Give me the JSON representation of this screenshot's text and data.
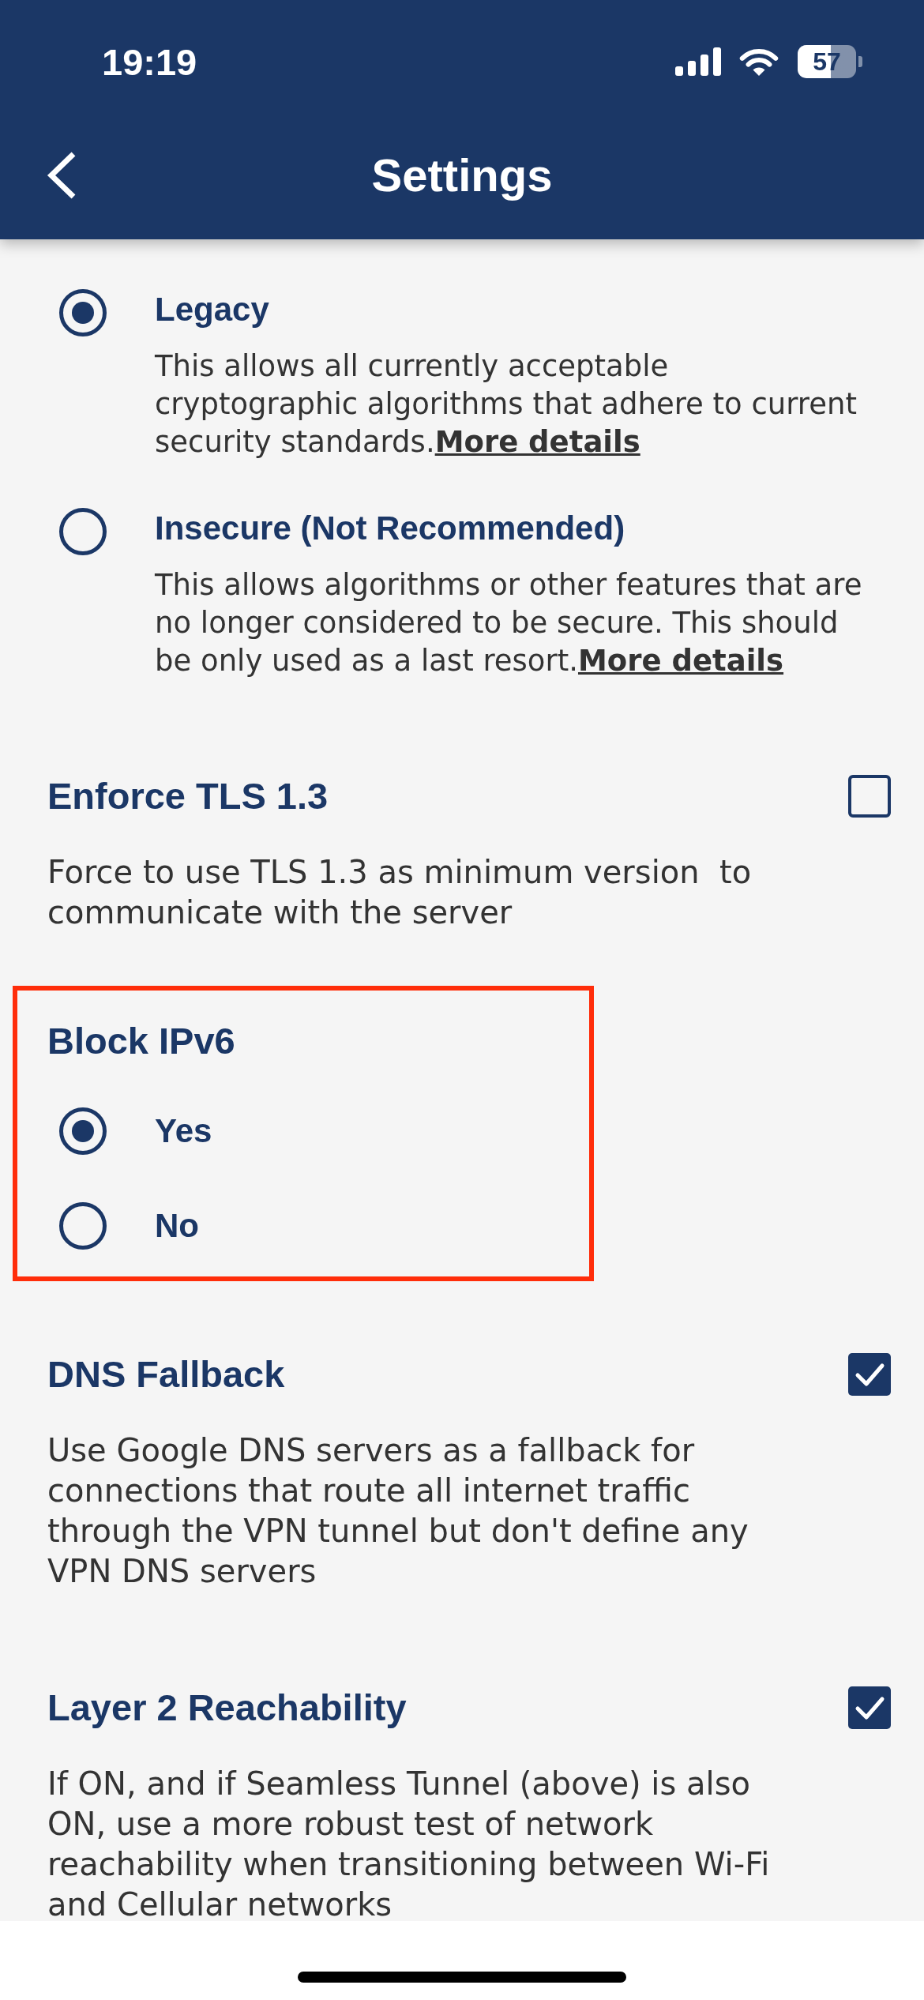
{
  "status_bar": {
    "time": "19:19",
    "battery": "57"
  },
  "header": {
    "title": "Settings"
  },
  "options": [
    {
      "label": "Legacy",
      "description": "This allows all currently acceptable cryptographic algorithms that adhere to current security standards.",
      "link": "More details",
      "selected": true
    },
    {
      "label": "Insecure (Not Recommended)",
      "description": "This allows algorithms or other features that are no longer considered to be secure. This should be only used as a last resort.",
      "link": "More details",
      "selected": false
    }
  ],
  "sections": [
    {
      "kind": "checkbox",
      "title": "Enforce TLS 1.3",
      "description": "Force to use TLS 1.3 as minimum version  to communicate with the server",
      "checked": false,
      "highlighted": false
    },
    {
      "kind": "radio_group",
      "title": "Block IPv6",
      "options": [
        {
          "label": "Yes",
          "selected": true
        },
        {
          "label": "No",
          "selected": false
        }
      ],
      "highlighted": true
    },
    {
      "kind": "checkbox",
      "title": "DNS Fallback",
      "description": "Use Google DNS servers as a fallback for connections that route all internet traffic through the VPN tunnel but don't define any VPN DNS servers",
      "checked": true,
      "highlighted": false
    },
    {
      "kind": "checkbox",
      "title": "Layer 2 Reachability",
      "description": "If ON, and if Seamless Tunnel (above) is also ON, use a more robust test of network reachability when transitioning between Wi-Fi and Cellular networks",
      "checked": true,
      "highlighted": false
    }
  ]
}
